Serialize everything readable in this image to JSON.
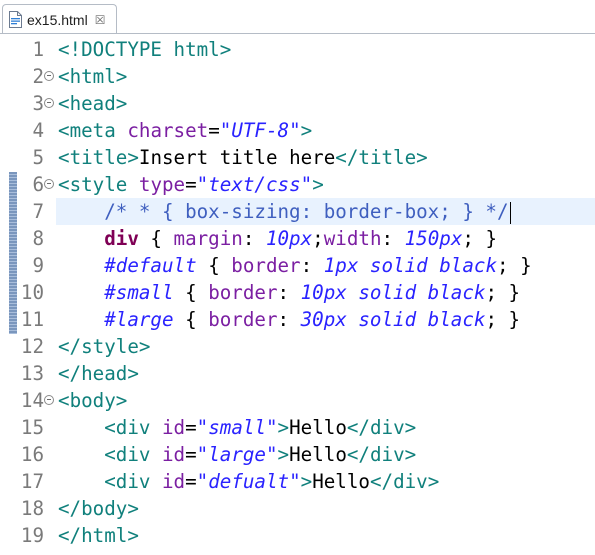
{
  "tab": {
    "icon": "html-file-icon",
    "title": "ex15.html",
    "close_glyph": "☒"
  },
  "editor": {
    "lines": [
      {
        "n": "1",
        "fold": false,
        "tokens": [
          [
            "punc",
            "<!"
          ],
          [
            "tag",
            "DOCTYPE html"
          ],
          [
            "punc",
            ">"
          ]
        ]
      },
      {
        "n": "2",
        "fold": true,
        "tokens": [
          [
            "punc",
            "<"
          ],
          [
            "tag",
            "html"
          ],
          [
            "punc",
            ">"
          ]
        ]
      },
      {
        "n": "3",
        "fold": true,
        "tokens": [
          [
            "punc",
            "<"
          ],
          [
            "tag",
            "head"
          ],
          [
            "punc",
            ">"
          ]
        ]
      },
      {
        "n": "4",
        "fold": false,
        "tokens": [
          [
            "punc",
            "<"
          ],
          [
            "tag",
            "meta"
          ],
          [
            "txt",
            " "
          ],
          [
            "attr",
            "charset"
          ],
          [
            "txt",
            "="
          ],
          [
            "sval",
            "\"UTF-8\""
          ],
          [
            "punc",
            ">"
          ]
        ]
      },
      {
        "n": "5",
        "fold": false,
        "tokens": [
          [
            "punc",
            "<"
          ],
          [
            "tag",
            "title"
          ],
          [
            "punc",
            ">"
          ],
          [
            "txt",
            "Insert title here"
          ],
          [
            "punc",
            "</"
          ],
          [
            "tag",
            "title"
          ],
          [
            "punc",
            ">"
          ]
        ]
      },
      {
        "n": "6",
        "fold": true,
        "tokens": [
          [
            "punc",
            "<"
          ],
          [
            "tag",
            "style"
          ],
          [
            "txt",
            " "
          ],
          [
            "attr",
            "type"
          ],
          [
            "txt",
            "="
          ],
          [
            "sval",
            "\"text/css\""
          ],
          [
            "punc",
            ">"
          ]
        ]
      },
      {
        "n": "7",
        "fold": false,
        "current": true,
        "tokens": [
          [
            "txt",
            "    "
          ],
          [
            "cmt",
            "/* * { box-sizing: border-box; } */"
          ]
        ]
      },
      {
        "n": "8",
        "fold": false,
        "tokens": [
          [
            "txt",
            "    "
          ],
          [
            "kw",
            "div"
          ],
          [
            "txt",
            " { "
          ],
          [
            "prop",
            "margin"
          ],
          [
            "txt",
            ": "
          ],
          [
            "num",
            "10px"
          ],
          [
            "txt",
            ";"
          ],
          [
            "prop",
            "width"
          ],
          [
            "txt",
            ": "
          ],
          [
            "num",
            "150px"
          ],
          [
            "txt",
            "; }"
          ]
        ]
      },
      {
        "n": "9",
        "fold": false,
        "tokens": [
          [
            "txt",
            "    "
          ],
          [
            "sel",
            "#default"
          ],
          [
            "txt",
            " { "
          ],
          [
            "prop",
            "border"
          ],
          [
            "txt",
            ": "
          ],
          [
            "num",
            "1px solid black"
          ],
          [
            "txt",
            "; }"
          ]
        ]
      },
      {
        "n": "10",
        "fold": false,
        "tokens": [
          [
            "txt",
            "    "
          ],
          [
            "sel",
            "#small"
          ],
          [
            "txt",
            " { "
          ],
          [
            "prop",
            "border"
          ],
          [
            "txt",
            ": "
          ],
          [
            "num",
            "10px solid black"
          ],
          [
            "txt",
            "; }"
          ]
        ]
      },
      {
        "n": "11",
        "fold": false,
        "tokens": [
          [
            "txt",
            "    "
          ],
          [
            "sel",
            "#large"
          ],
          [
            "txt",
            " { "
          ],
          [
            "prop",
            "border"
          ],
          [
            "txt",
            ": "
          ],
          [
            "num",
            "30px solid black"
          ],
          [
            "txt",
            "; }"
          ]
        ]
      },
      {
        "n": "12",
        "fold": false,
        "tokens": [
          [
            "punc",
            "</"
          ],
          [
            "tag",
            "style"
          ],
          [
            "punc",
            ">"
          ]
        ]
      },
      {
        "n": "13",
        "fold": false,
        "tokens": [
          [
            "punc",
            "</"
          ],
          [
            "tag",
            "head"
          ],
          [
            "punc",
            ">"
          ]
        ]
      },
      {
        "n": "14",
        "fold": true,
        "tokens": [
          [
            "punc",
            "<"
          ],
          [
            "tag",
            "body"
          ],
          [
            "punc",
            ">"
          ]
        ]
      },
      {
        "n": "15",
        "fold": false,
        "tokens": [
          [
            "txt",
            "    "
          ],
          [
            "punc",
            "<"
          ],
          [
            "tag",
            "div"
          ],
          [
            "txt",
            " "
          ],
          [
            "attr",
            "id"
          ],
          [
            "txt",
            "="
          ],
          [
            "sval",
            "\"small\""
          ],
          [
            "punc",
            ">"
          ],
          [
            "txt",
            "Hello"
          ],
          [
            "punc",
            "</"
          ],
          [
            "tag",
            "div"
          ],
          [
            "punc",
            ">"
          ]
        ]
      },
      {
        "n": "16",
        "fold": false,
        "tokens": [
          [
            "txt",
            "    "
          ],
          [
            "punc",
            "<"
          ],
          [
            "tag",
            "div"
          ],
          [
            "txt",
            " "
          ],
          [
            "attr",
            "id"
          ],
          [
            "txt",
            "="
          ],
          [
            "sval",
            "\"large\""
          ],
          [
            "punc",
            ">"
          ],
          [
            "txt",
            "Hello"
          ],
          [
            "punc",
            "</"
          ],
          [
            "tag",
            "div"
          ],
          [
            "punc",
            ">"
          ]
        ]
      },
      {
        "n": "17",
        "fold": false,
        "tokens": [
          [
            "txt",
            "    "
          ],
          [
            "punc",
            "<"
          ],
          [
            "tag",
            "div"
          ],
          [
            "txt",
            " "
          ],
          [
            "attr",
            "id"
          ],
          [
            "txt",
            "="
          ],
          [
            "sval",
            "\"defualt\""
          ],
          [
            "punc",
            ">"
          ],
          [
            "txt",
            "Hello"
          ],
          [
            "punc",
            "</"
          ],
          [
            "tag",
            "div"
          ],
          [
            "punc",
            ">"
          ]
        ]
      },
      {
        "n": "18",
        "fold": false,
        "tokens": [
          [
            "punc",
            "</"
          ],
          [
            "tag",
            "body"
          ],
          [
            "punc",
            ">"
          ]
        ]
      },
      {
        "n": "19",
        "fold": false,
        "tokens": [
          [
            "punc",
            "</"
          ],
          [
            "tag",
            "html"
          ],
          [
            "punc",
            ">"
          ]
        ]
      }
    ]
  },
  "colors": {
    "tag": "#10807c",
    "attribute": "#7b1fa2",
    "string": "#2a23ff",
    "comment": "#3f5fbf",
    "keyword": "#7f0055",
    "current_line": "#e8f2fe"
  }
}
